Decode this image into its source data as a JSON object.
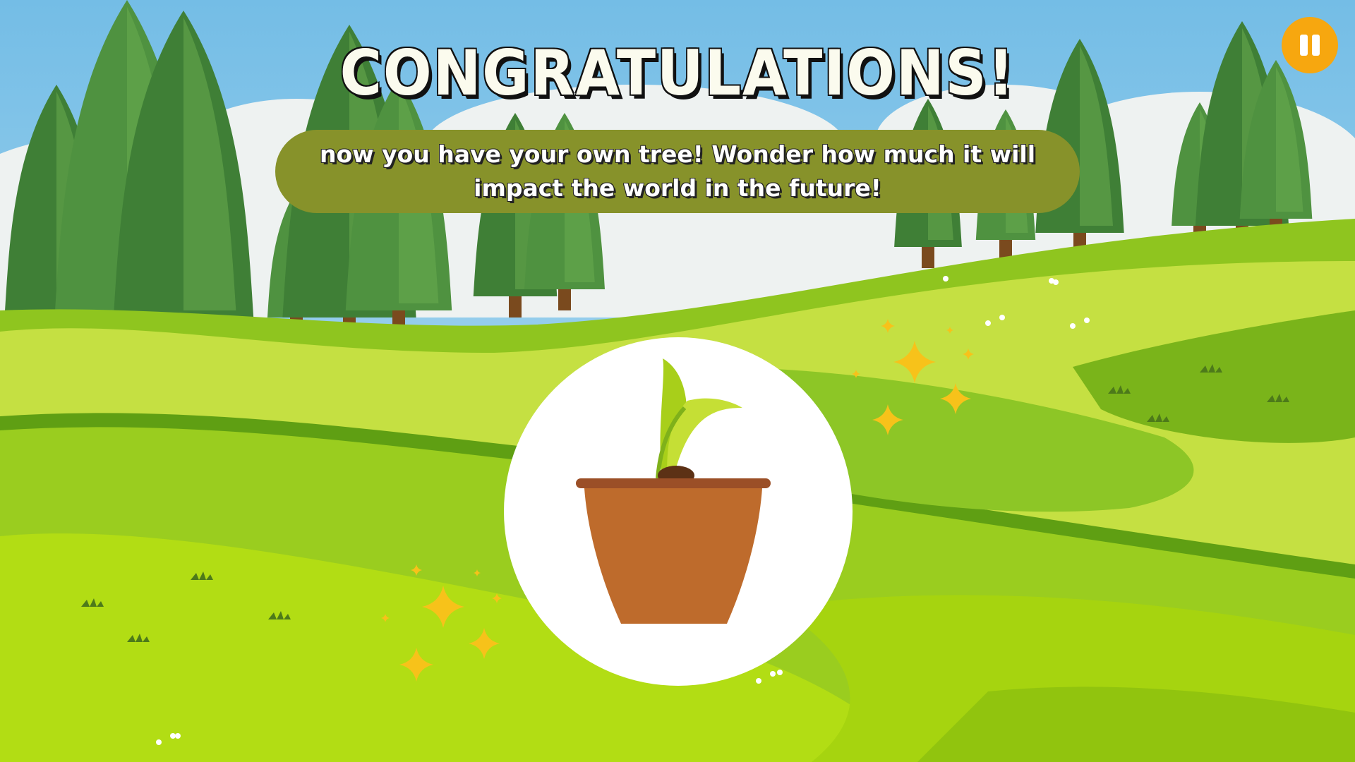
{
  "screen": {
    "title": "CONGRATULATIONS!",
    "message": "now you have your own tree! Wonder how much it will impact the world in the future!"
  },
  "controls": {
    "pause_icon": "pause-icon"
  },
  "colors": {
    "sky": "#7fc1e8",
    "grass_light": "#c6e03c",
    "grass_mid": "#8fc41e",
    "grass_dark": "#5a9a12",
    "tree": "#4e8f3a",
    "banner": "#87922a",
    "pause_button": "#f7a70f",
    "pot": "#be6b2c",
    "sparkle": "#f7c21a"
  }
}
